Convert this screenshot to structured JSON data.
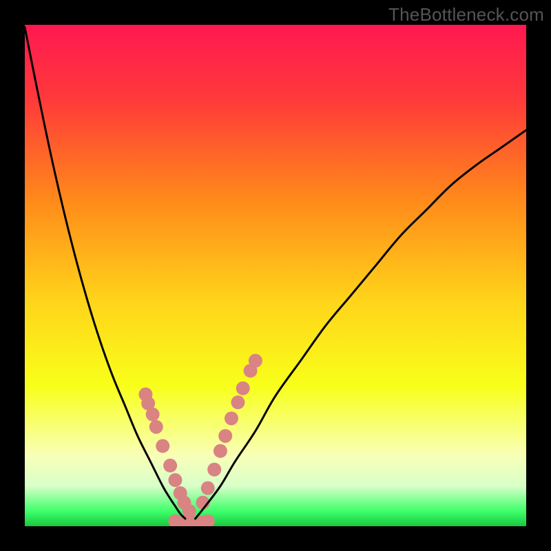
{
  "watermark": "TheBottleneck.com",
  "chart_data": {
    "type": "line",
    "title": "",
    "xlabel": "",
    "ylabel": "",
    "series": [
      {
        "name": "left-curve",
        "x": [
          0.0,
          0.025,
          0.05,
          0.075,
          0.1,
          0.125,
          0.15,
          0.175,
          0.2,
          0.225,
          0.25,
          0.275,
          0.29,
          0.3,
          0.31,
          0.32
        ],
        "y": [
          0.995,
          0.87,
          0.75,
          0.64,
          0.54,
          0.45,
          0.37,
          0.3,
          0.24,
          0.18,
          0.13,
          0.08,
          0.055,
          0.04,
          0.025,
          0.015
        ]
      },
      {
        "name": "right-curve",
        "x": [
          0.34,
          0.36,
          0.39,
          0.42,
          0.46,
          0.5,
          0.55,
          0.6,
          0.65,
          0.7,
          0.75,
          0.8,
          0.85,
          0.9,
          0.95,
          1.0
        ],
        "y": [
          0.015,
          0.04,
          0.08,
          0.13,
          0.19,
          0.26,
          0.33,
          0.4,
          0.46,
          0.52,
          0.58,
          0.63,
          0.68,
          0.72,
          0.755,
          0.79
        ]
      },
      {
        "name": "dots-left",
        "x": [
          0.241,
          0.246,
          0.255,
          0.262,
          0.275,
          0.29,
          0.3,
          0.31,
          0.318,
          0.328
        ],
        "y": [
          0.263,
          0.245,
          0.223,
          0.198,
          0.16,
          0.121,
          0.092,
          0.066,
          0.047,
          0.03
        ]
      },
      {
        "name": "dots-right",
        "x": [
          0.355,
          0.365,
          0.378,
          0.39,
          0.4,
          0.412,
          0.425,
          0.435,
          0.45,
          0.46
        ],
        "y": [
          0.047,
          0.076,
          0.113,
          0.15,
          0.18,
          0.215,
          0.247,
          0.275,
          0.31,
          0.33
        ]
      },
      {
        "name": "dots-bottom",
        "x": [
          0.3,
          0.315,
          0.328,
          0.34,
          0.352,
          0.365
        ],
        "y": [
          0.01,
          0.007,
          0.006,
          0.006,
          0.007,
          0.01
        ]
      }
    ],
    "background_gradient": {
      "stops": [
        {
          "offset": 0.0,
          "color": "#ff1850"
        },
        {
          "offset": 0.15,
          "color": "#ff3a3a"
        },
        {
          "offset": 0.35,
          "color": "#ff8a1a"
        },
        {
          "offset": 0.55,
          "color": "#ffd41a"
        },
        {
          "offset": 0.72,
          "color": "#f8ff1a"
        },
        {
          "offset": 0.86,
          "color": "#f8ffb8"
        },
        {
          "offset": 0.92,
          "color": "#d8ffc8"
        },
        {
          "offset": 0.97,
          "color": "#3fff6a"
        },
        {
          "offset": 1.0,
          "color": "#18c840"
        }
      ]
    },
    "curve_style": {
      "stroke": "#000000",
      "stroke_width": 3.0
    },
    "dot_style": {
      "fill": "#d98383",
      "radius": 10
    }
  }
}
